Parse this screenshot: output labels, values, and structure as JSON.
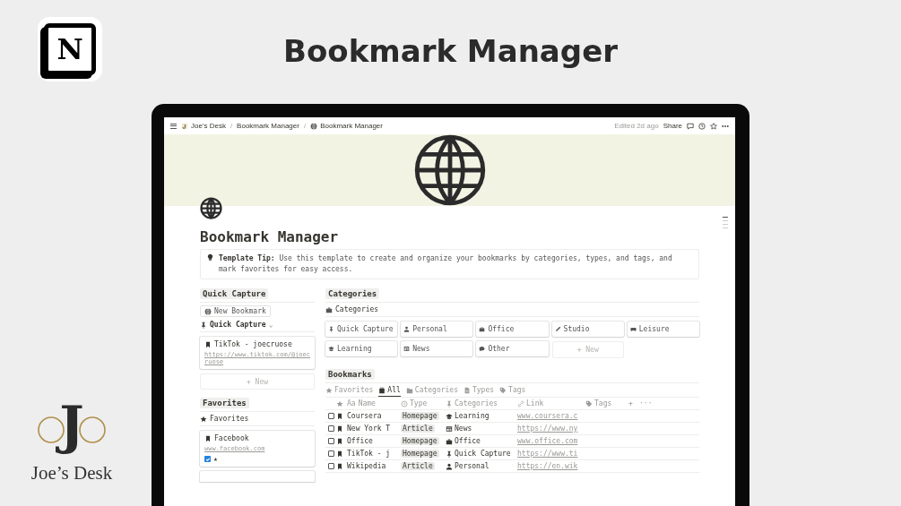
{
  "brand": {
    "logo_letter": "N",
    "headline": "Bookmark Manager",
    "monogram": "J",
    "name": "Joe’s Desk"
  },
  "topbar": {
    "breadcrumbs": [
      {
        "label": "Joe's Desk",
        "kind": "monogram"
      },
      {
        "label": "Bookmark Manager",
        "kind": "plain"
      },
      {
        "label": "Bookmark Manager",
        "kind": "globe"
      }
    ],
    "separator": "/",
    "edited": "Edited 2d ago",
    "share": "Share"
  },
  "page": {
    "title": "Bookmark Manager",
    "tip": "**Template Tip:** Use this template to create and organize your bookmarks by categories, types, and tags, and mark favorites for easy access."
  },
  "quick_capture": {
    "heading": "Quick Capture",
    "new_button": "New Bookmark",
    "view": "Quick Capture",
    "caret": "⌄",
    "cards": [
      {
        "title": "TikTok - joecruose",
        "url": "https://www.tiktok.com/@joecruose"
      }
    ],
    "new": "+ New"
  },
  "favorites": {
    "heading": "Favorites",
    "view": "Favorites",
    "cards": [
      {
        "title": "Facebook",
        "url": "www.facebook.com",
        "checked": true,
        "mark": "★"
      }
    ]
  },
  "categories": {
    "heading": "Categories",
    "view": "Categories",
    "items": [
      {
        "label": "Quick Capture",
        "kind": "pin"
      },
      {
        "label": "Personal",
        "kind": "person"
      },
      {
        "label": "Office",
        "kind": "briefcase"
      },
      {
        "label": "Studio",
        "kind": "pencil"
      },
      {
        "label": "Leisure",
        "kind": "gamepad"
      },
      {
        "label": "Learning",
        "kind": "school"
      },
      {
        "label": "News",
        "kind": "newspaper"
      },
      {
        "label": "Other",
        "kind": "chat"
      }
    ],
    "new": "+ New"
  },
  "bookmarks": {
    "heading": "Bookmarks",
    "tabs": [
      {
        "label": "Favorites",
        "kind": "star",
        "selected": false
      },
      {
        "label": "All",
        "kind": "stack",
        "selected": true
      },
      {
        "label": "Categories",
        "kind": "folder",
        "selected": false
      },
      {
        "label": "Types",
        "kind": "doc",
        "selected": false
      },
      {
        "label": "Tags",
        "kind": "tag",
        "selected": false
      }
    ],
    "columns": [
      {
        "label": "Name",
        "prefix": "Aa",
        "kind": "title"
      },
      {
        "label": "Type",
        "kind": "circle"
      },
      {
        "label": "Categories",
        "kind": "pin"
      },
      {
        "label": "Link",
        "kind": "link"
      },
      {
        "label": "Tags",
        "kind": "tag"
      }
    ],
    "add": "+",
    "more": "···",
    "rows": [
      {
        "checked": false,
        "name": "Coursera",
        "type": "Homepage",
        "category": {
          "label": "Learning",
          "kind": "school"
        },
        "link": "www.coursera.c"
      },
      {
        "checked": false,
        "name": "New York T",
        "type": "Article",
        "category": {
          "label": "News",
          "kind": "newspaper"
        },
        "link": "https://www.ny"
      },
      {
        "checked": false,
        "name": "Office",
        "type": "Homepage",
        "category": {
          "label": "Office",
          "kind": "briefcase"
        },
        "link": "www.office.com"
      },
      {
        "checked": false,
        "name": "TikTok - j",
        "type": "Homepage",
        "category": {
          "label": "Quick Capture",
          "kind": "pin"
        },
        "link": "https://www.ti"
      },
      {
        "checked": false,
        "name": "Wikipedia",
        "type": "Article",
        "category": {
          "label": "Personal",
          "kind": "person"
        },
        "link": "https://en.wik"
      }
    ]
  }
}
